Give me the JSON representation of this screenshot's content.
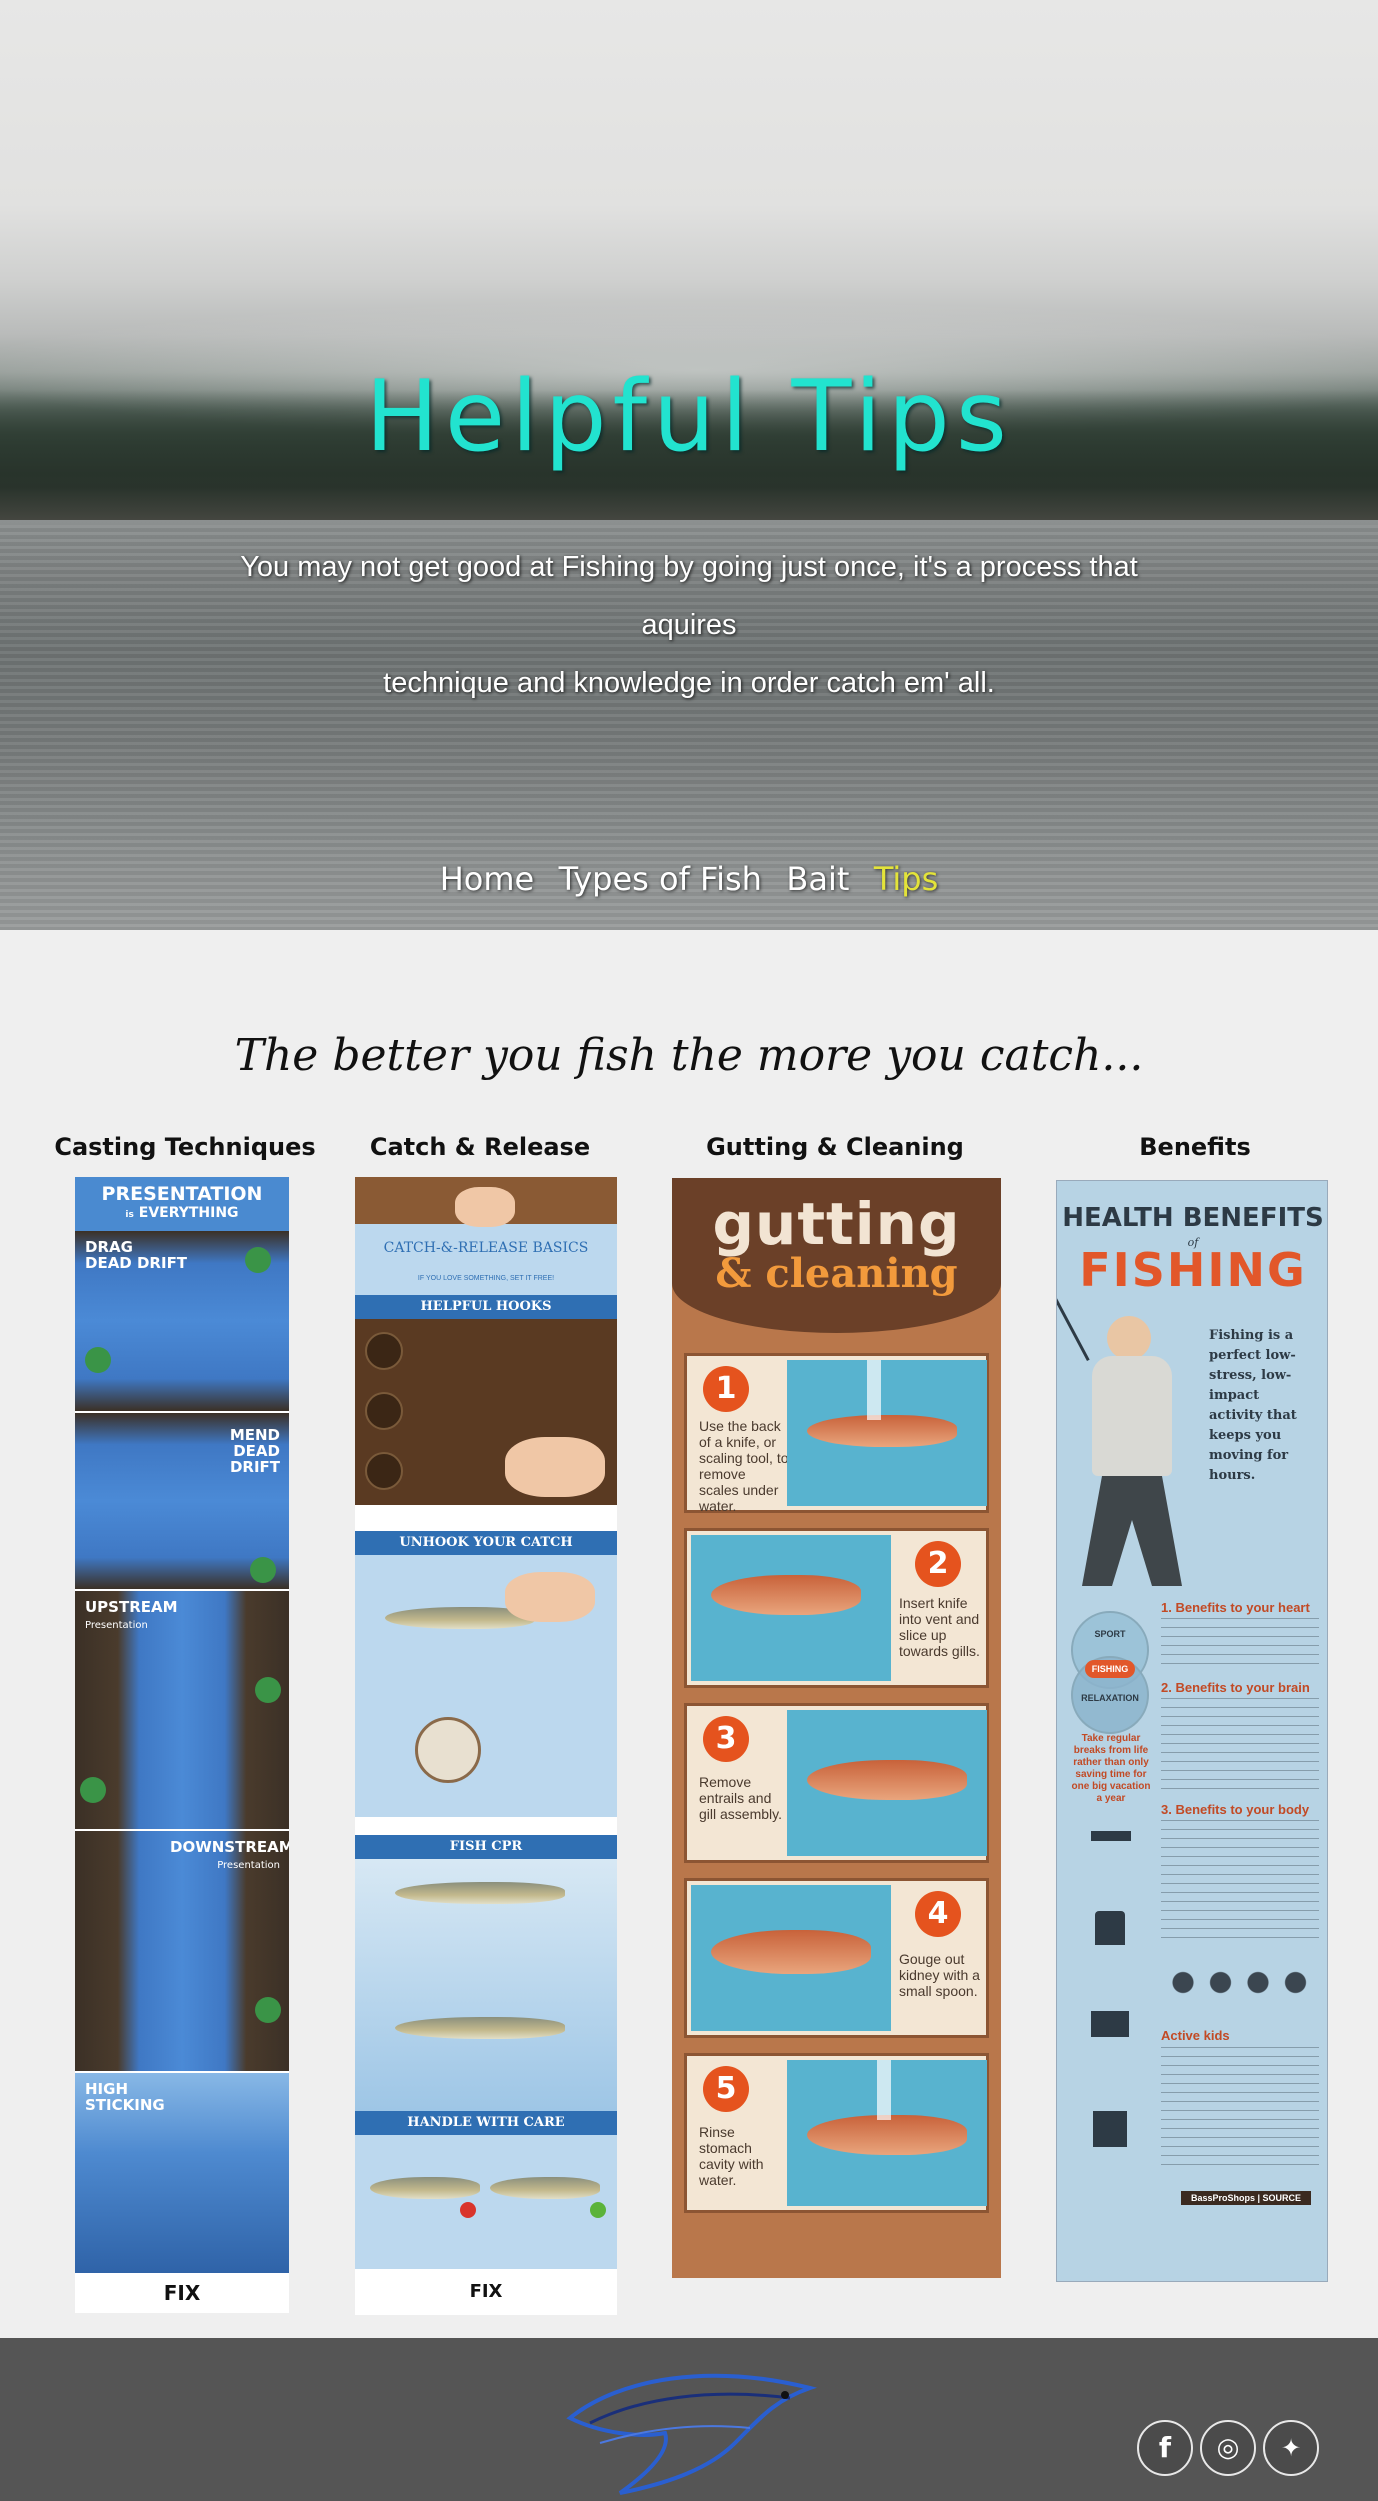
{
  "hero": {
    "title": "Helpful Tips",
    "subtitle_line1": "You may not get good at Fishing by going just once, it's a process that aquires",
    "subtitle_line2": "technique and knowledge in order catch em' all."
  },
  "nav": {
    "items": [
      {
        "label": "Home",
        "active": false
      },
      {
        "label": "Types of Fish",
        "active": false
      },
      {
        "label": "Bait",
        "active": false
      },
      {
        "label": "Tips",
        "active": true
      }
    ],
    "active_color": "#e3e33a"
  },
  "tagline": "The better you fish the more you catch...",
  "columns": {
    "casting": {
      "title": "Casting Techniques",
      "header1": "PRESENTATION",
      "header2": "EVERYTHING",
      "header_small": "is",
      "sections": [
        "DRAG",
        "DEAD DRIFT",
        "MEND",
        "DEAD DRIFT",
        "UPSTREAM",
        "Presentation",
        "DOWNSTREAM",
        "Presentation",
        "HIGH",
        "STICKING"
      ],
      "footer_logo": "FIX"
    },
    "catch": {
      "title": "Catch & Release",
      "banner": "CATCH-&-RELEASE BASICS",
      "banner_sub": "IF YOU LOVE SOMETHING, SET IT FREE!",
      "sections": [
        "HELPFUL HOOKS",
        "UNHOOK YOUR CATCH",
        "FISH CPR",
        "HANDLE WITH CARE"
      ],
      "footer_logo": "FIX"
    },
    "gutting": {
      "title": "Gutting & Cleaning",
      "word1": "gutting",
      "word2": "& cleaning",
      "steps": [
        {
          "n": "1",
          "text": "Use the back of a knife, or scaling tool, to remove scales under water."
        },
        {
          "n": "2",
          "text": "Insert knife into vent and slice up towards gills."
        },
        {
          "n": "3",
          "text": "Remove entrails and gill assembly."
        },
        {
          "n": "4",
          "text": "Gouge out kidney with a small spoon."
        },
        {
          "n": "5",
          "text": "Rinse stomach cavity with water."
        }
      ]
    },
    "benefits": {
      "title": "Benefits",
      "heading1": "HEALTH BENEFITS",
      "heading_of": "of",
      "heading2": "FISHING",
      "intro": "Fishing is a perfect low-stress, low-impact activity that keeps you moving for hours.",
      "venn": [
        "SPORT",
        "FISHING",
        "RELAXATION"
      ],
      "callout": "Take regular breaks from life rather than only saving time for one big vacation a year",
      "benefit_heads": [
        "1. Benefits to your heart",
        "2. Benefits to your brain",
        "3. Benefits to your body",
        "Active kids"
      ],
      "footer_logo": "BassProShops | SOURCE"
    }
  },
  "footer": {
    "social": [
      {
        "icon": "facebook-icon",
        "glyph": "f"
      },
      {
        "icon": "instagram-icon",
        "glyph": "◎"
      },
      {
        "icon": "twitter-icon",
        "glyph": "✦"
      }
    ]
  }
}
